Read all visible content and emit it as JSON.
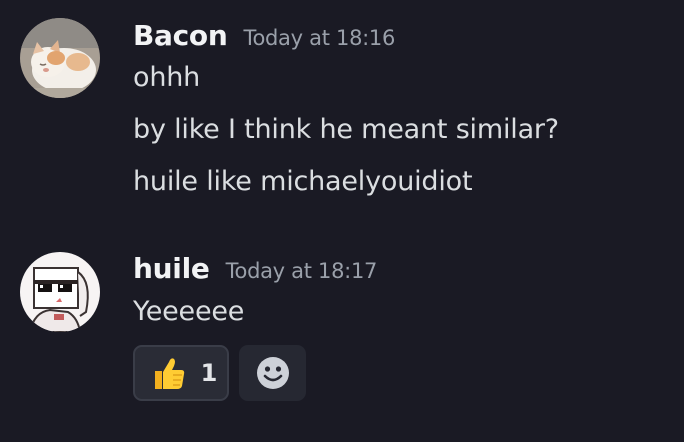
{
  "messages": [
    {
      "username": "Bacon",
      "timestamp": "Today at 18:16",
      "avatar": "cat-avatar",
      "lines": [
        "ohhh",
        "by like I think he meant similar?",
        "huile like michaelyouidiot"
      ]
    },
    {
      "username": "huile",
      "timestamp": "Today at 18:17",
      "avatar": "sunglasses-character-avatar",
      "lines": [
        "Yeeeeee"
      ],
      "reactions": [
        {
          "icon": "thumbs-up-icon",
          "count": "1"
        }
      ],
      "add_reaction_icon": "smiley-face-icon"
    }
  ],
  "colors": {
    "background": "#1a1a24",
    "username": "#f2f3f5",
    "timestamp": "#9aa0aa",
    "message_text": "#dbdee1",
    "reaction_bg": "#2a2c36"
  }
}
